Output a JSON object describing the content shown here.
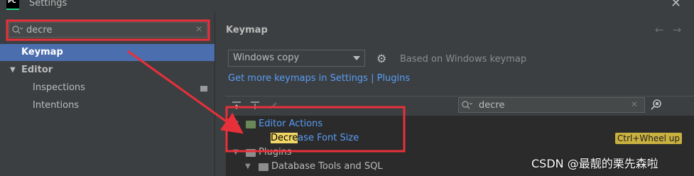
{
  "window": {
    "title": "Settings",
    "app_logo": "PC",
    "close_glyph": "✕"
  },
  "sidebar": {
    "search": {
      "value": "decre",
      "placeholder": ""
    },
    "items": [
      {
        "label": "Keymap",
        "selected": true
      },
      {
        "label": "Editor",
        "expanded": true
      },
      {
        "label": "Inspections"
      },
      {
        "label": "Intentions"
      }
    ]
  },
  "panel": {
    "title": "Keymap",
    "keymap_select": {
      "value": "Windows copy"
    },
    "based_on": "Based on Windows keymap",
    "get_more_link": "Get more keymaps in Settings | Plugins",
    "action_search": {
      "value": "decre"
    }
  },
  "tree": {
    "editor_actions": "Editor Actions",
    "action": {
      "match": "Decre",
      "rest": "ase Font Size",
      "shortcut": "Ctrl+Wheel up"
    },
    "plugins": "Plugins",
    "database_tools": "Database Tools and SQL"
  },
  "icons": [
    "search-icon",
    "clear-icon",
    "chevron-down-icon",
    "reset-icon",
    "back-arrow-icon",
    "forward-arrow-icon",
    "dropdown-arrow-icon",
    "gear-icon",
    "expand-all-icon",
    "collapse-all-icon",
    "edit-icon",
    "find-shortcut-icon",
    "folder-icon"
  ],
  "annotation_color": "#e8303a",
  "watermark": "CSDN @最靓的栗先森啦"
}
